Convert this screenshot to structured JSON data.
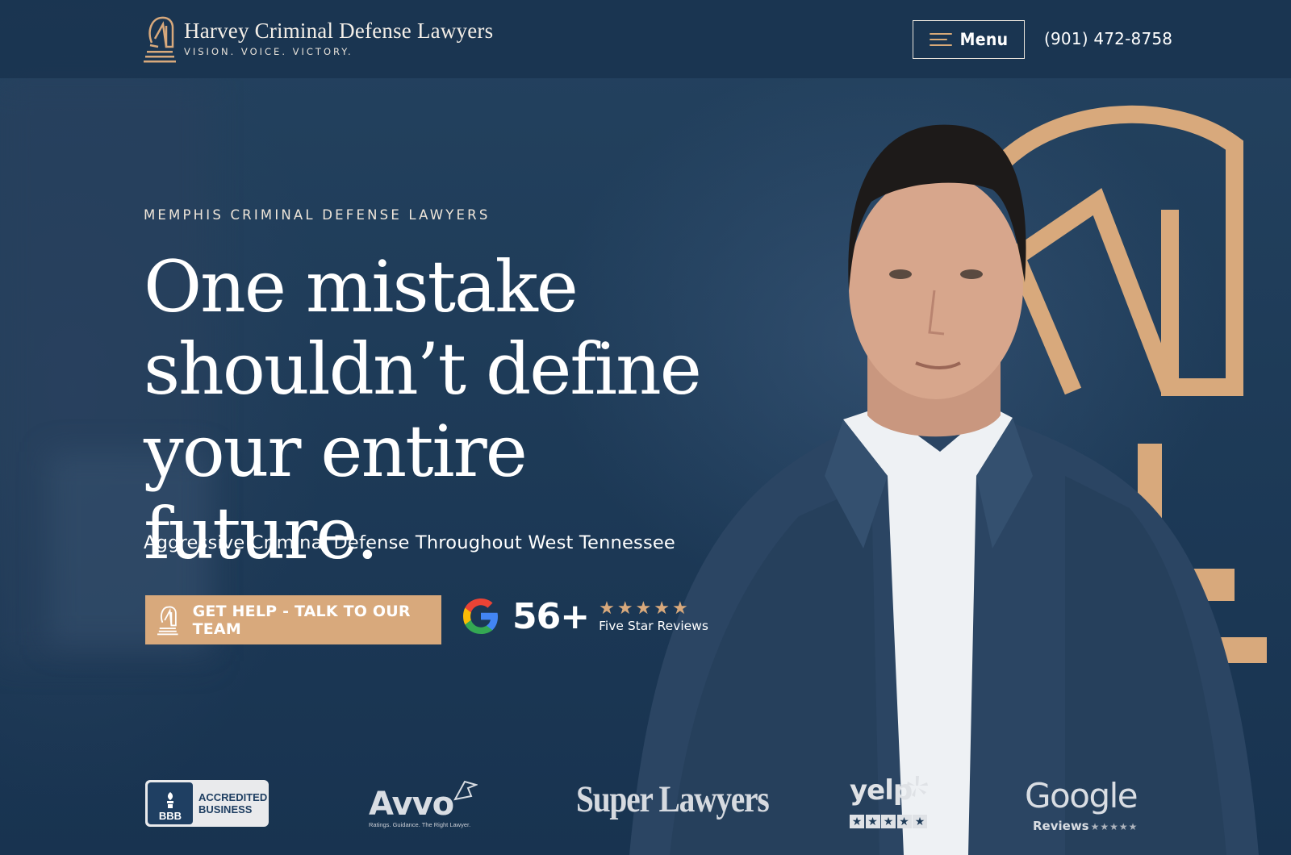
{
  "header": {
    "logo_title": "Harvey Criminal Defense Lawyers",
    "logo_tagline": "VISION. VOICE. VICTORY.",
    "menu_label": "Menu",
    "phone": "(901) 472-8758"
  },
  "hero": {
    "eyebrow": "MEMPHIS CRIMINAL DEFENSE LAWYERS",
    "headline_line1": "One mistake",
    "headline_line2": "shouldn’t define",
    "headline_line3": "your entire future.",
    "subhead": "Aggressive Criminal Defense Throughout West Tennessee",
    "cta_label": "GET HELP - TALK TO OUR TEAM",
    "reviews": {
      "count": "56+",
      "stars": "★★★★★",
      "label": "Five Star Reviews"
    }
  },
  "badges": {
    "bbb_symbol": "BBB",
    "bbb_line1": "ACCREDITED",
    "bbb_line2": "BUSINESS",
    "avvo": "Avvo",
    "avvo_sub": "Ratings. Guidance. The Right Lawyer.",
    "super_lawyers": "Super Lawyers",
    "yelp": "yelp",
    "google": "Google",
    "google_sub": "Reviews",
    "google_stars": "★★★★★"
  },
  "colors": {
    "navy": "#1d3a57",
    "accent_gold": "#d8a97c",
    "white": "#ffffff"
  }
}
